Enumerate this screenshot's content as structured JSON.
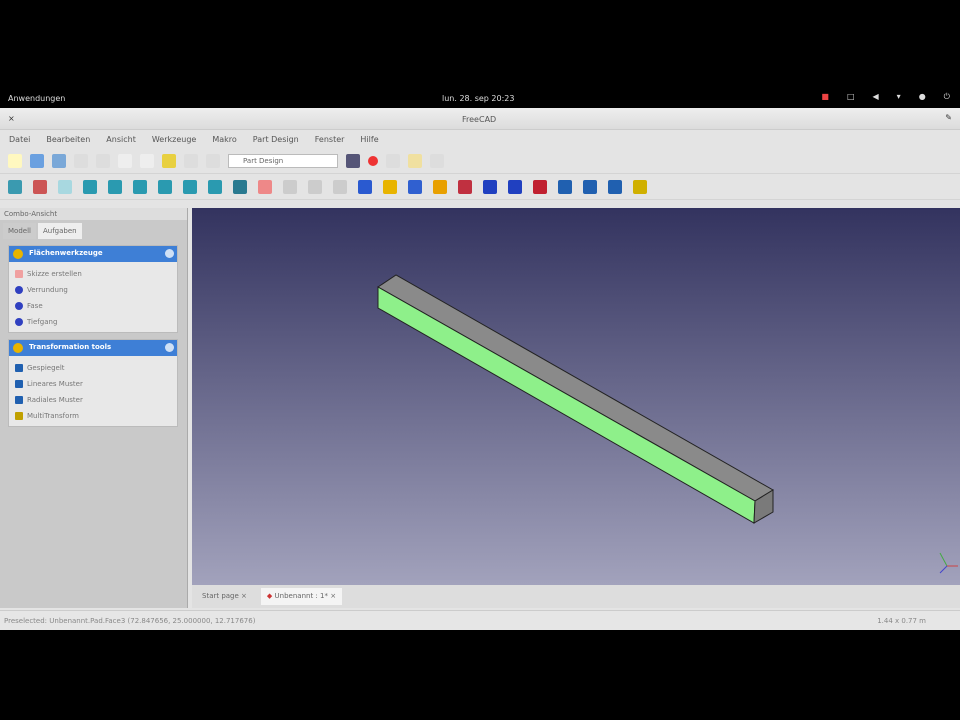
{
  "system": {
    "activities": "Anwendungen",
    "clock": "lun. 28. sep 20:23"
  },
  "window": {
    "title": "FreeCAD"
  },
  "menu": [
    "Datei",
    "Bearbeiten",
    "Ansicht",
    "Werkzeuge",
    "Makro",
    "Part Design",
    "Fenster",
    "Hilfe"
  ],
  "toolbar": {
    "workbench": "Part Design"
  },
  "combo": {
    "title": "Combo-Ansicht",
    "tabs": [
      "Modell",
      "Aufgaben"
    ]
  },
  "panels": [
    {
      "title": "Flächenwerkzeuge",
      "items": [
        "Skizze erstellen",
        "Verrundung",
        "Fase",
        "Tiefgang"
      ]
    },
    {
      "title": "Transformation tools",
      "items": [
        "Gespiegelt",
        "Lineares Muster",
        "Radiales Muster",
        "MultiTransform"
      ]
    }
  ],
  "doc_tabs": [
    "Start page",
    "Unbenannt : 1*"
  ],
  "status": {
    "message": "Preselected: Unbenannt.Pad.Face3 (72.847656, 25.000000, 12.717676)",
    "dimensions": "1.44 x 0.77 m"
  },
  "colors": {
    "face": "#8ef08a",
    "top": "#8a8a8a",
    "accent": "#3e7fd6"
  }
}
